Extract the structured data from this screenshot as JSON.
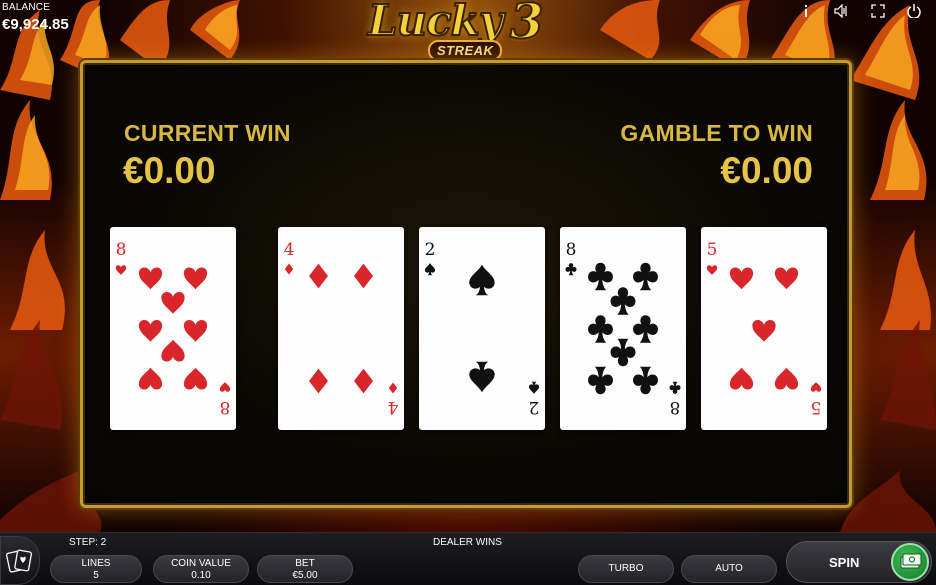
{
  "header": {
    "balance_label": "BALANCE",
    "balance_value": "€9,924.85",
    "icons": [
      "info-icon",
      "sound-icon",
      "fullscreen-icon",
      "power-icon"
    ]
  },
  "logo": {
    "main": "Lucky",
    "number": "3",
    "sub": "STREAK"
  },
  "gamble_panel": {
    "current_win_label": "CURRENT WIN",
    "current_win_value": "€0.00",
    "gamble_to_win_label": "GAMBLE TO WIN",
    "gamble_to_win_value": "€0.00",
    "cards": [
      {
        "rank": "8",
        "suit": "hearts",
        "color": "#d8262b"
      },
      {
        "rank": "4",
        "suit": "diamonds",
        "color": "#d8262b"
      },
      {
        "rank": "2",
        "suit": "spades",
        "color": "#111111"
      },
      {
        "rank": "8",
        "suit": "clubs",
        "color": "#111111"
      },
      {
        "rank": "5",
        "suit": "hearts",
        "color": "#d8262b"
      }
    ]
  },
  "bottom_bar": {
    "step": "STEP: 2",
    "status": "DEALER WINS",
    "lines_label": "LINES",
    "lines_value": "5",
    "coin_label": "COIN VALUE",
    "coin_value": "0.10",
    "bet_label": "BET",
    "bet_value": "€5.00",
    "turbo_label": "TURBO",
    "auto_label": "AUTO",
    "spin_label": "SPIN"
  },
  "colors": {
    "gold": "#e6c345",
    "panel_border": "#c79a2c",
    "red_suit": "#d8262b",
    "black_suit": "#111111"
  }
}
